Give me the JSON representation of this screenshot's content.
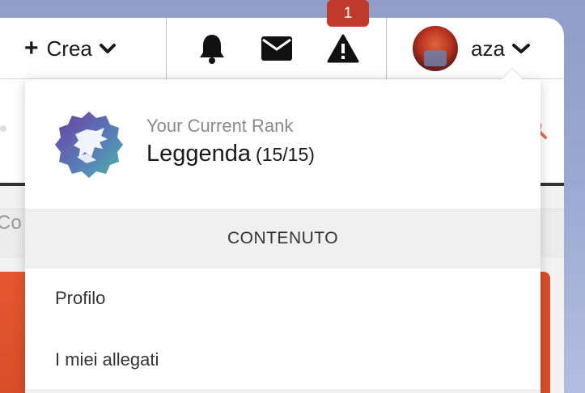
{
  "topbar": {
    "create_label": "Crea",
    "notification_badge": "1",
    "username": "aza"
  },
  "rank": {
    "caption": "Your Current Rank",
    "name": "Leggenda",
    "progress": "(15/15)"
  },
  "menu": {
    "section_title": "CONTENUTO",
    "items": [
      {
        "label": "Profilo"
      },
      {
        "label": "I miei allegati"
      }
    ]
  },
  "background": {
    "partial_text": "Co"
  },
  "colors": {
    "badge": "#c0392b",
    "accent_orange": "#d94e2a",
    "rank_icon_gradient": [
      "#6a3fa0",
      "#4bb3a8"
    ]
  }
}
